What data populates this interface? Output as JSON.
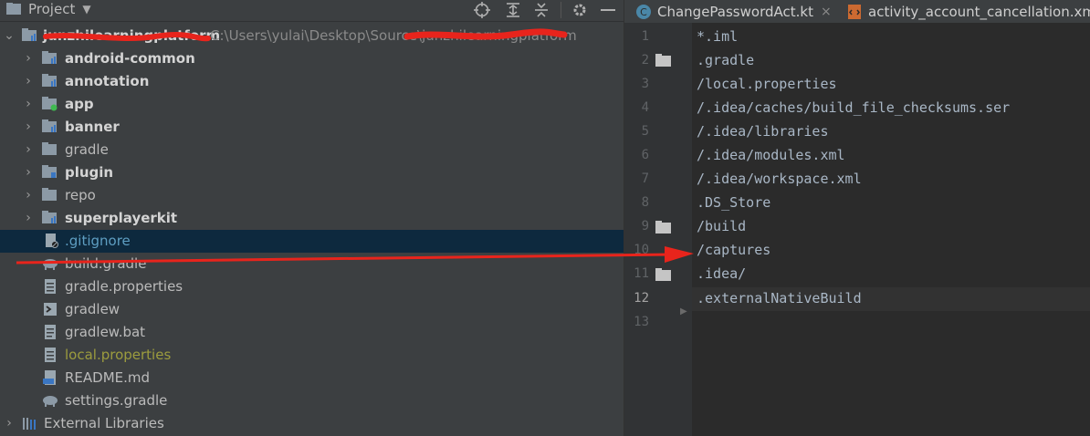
{
  "project_panel": {
    "title": "Project",
    "tree": [
      {
        "label": "junzhilearningplatform",
        "path": "C:\\Users\\yulai\\Desktop\\Source\\junzhilearningplatform",
        "kind": "project-root"
      },
      {
        "label": "android-common",
        "kind": "module"
      },
      {
        "label": "annotation",
        "kind": "module"
      },
      {
        "label": "app",
        "kind": "app-module"
      },
      {
        "label": "banner",
        "kind": "module"
      },
      {
        "label": "gradle",
        "kind": "folder"
      },
      {
        "label": "plugin",
        "kind": "module"
      },
      {
        "label": "repo",
        "kind": "folder"
      },
      {
        "label": "superplayerkit",
        "kind": "module"
      },
      {
        "label": ".gitignore",
        "kind": "gitignore-file"
      },
      {
        "label": "build.gradle",
        "kind": "gradle-file"
      },
      {
        "label": "gradle.properties",
        "kind": "properties-file"
      },
      {
        "label": "gradlew",
        "kind": "shell-file"
      },
      {
        "label": "gradlew.bat",
        "kind": "text-file"
      },
      {
        "label": "local.properties",
        "kind": "properties-file"
      },
      {
        "label": "README.md",
        "kind": "markdown-file"
      },
      {
        "label": "settings.gradle",
        "kind": "gradle-file"
      },
      {
        "label": "External Libraries",
        "kind": "libraries"
      }
    ]
  },
  "editor": {
    "tabs": [
      {
        "label": "ChangePasswordAct.kt",
        "close": "×"
      },
      {
        "label": "activity_account_cancellation.xml"
      }
    ],
    "lines": [
      {
        "number": "1",
        "text": "*.iml"
      },
      {
        "number": "2",
        "text": ".gradle"
      },
      {
        "number": "3",
        "text": "/local.properties"
      },
      {
        "number": "4",
        "text": "/.idea/caches/build_file_checksums.ser"
      },
      {
        "number": "5",
        "text": "/.idea/libraries"
      },
      {
        "number": "6",
        "text": "/.idea/modules.xml"
      },
      {
        "number": "7",
        "text": "/.idea/workspace.xml"
      },
      {
        "number": "8",
        "text": ".DS_Store"
      },
      {
        "number": "9",
        "text": "/build"
      },
      {
        "number": "10",
        "text": "/captures"
      },
      {
        "number": "11",
        "text": ".idea/"
      },
      {
        "number": "12",
        "text": ".externalNativeBuild"
      },
      {
        "number": "13",
        "text": ""
      }
    ]
  },
  "colors": {
    "panel_bg": "#3c3f41",
    "editor_bg": "#2b2b2b",
    "selection_bg": "#0d293e",
    "annotation_red": "#e8241c"
  }
}
